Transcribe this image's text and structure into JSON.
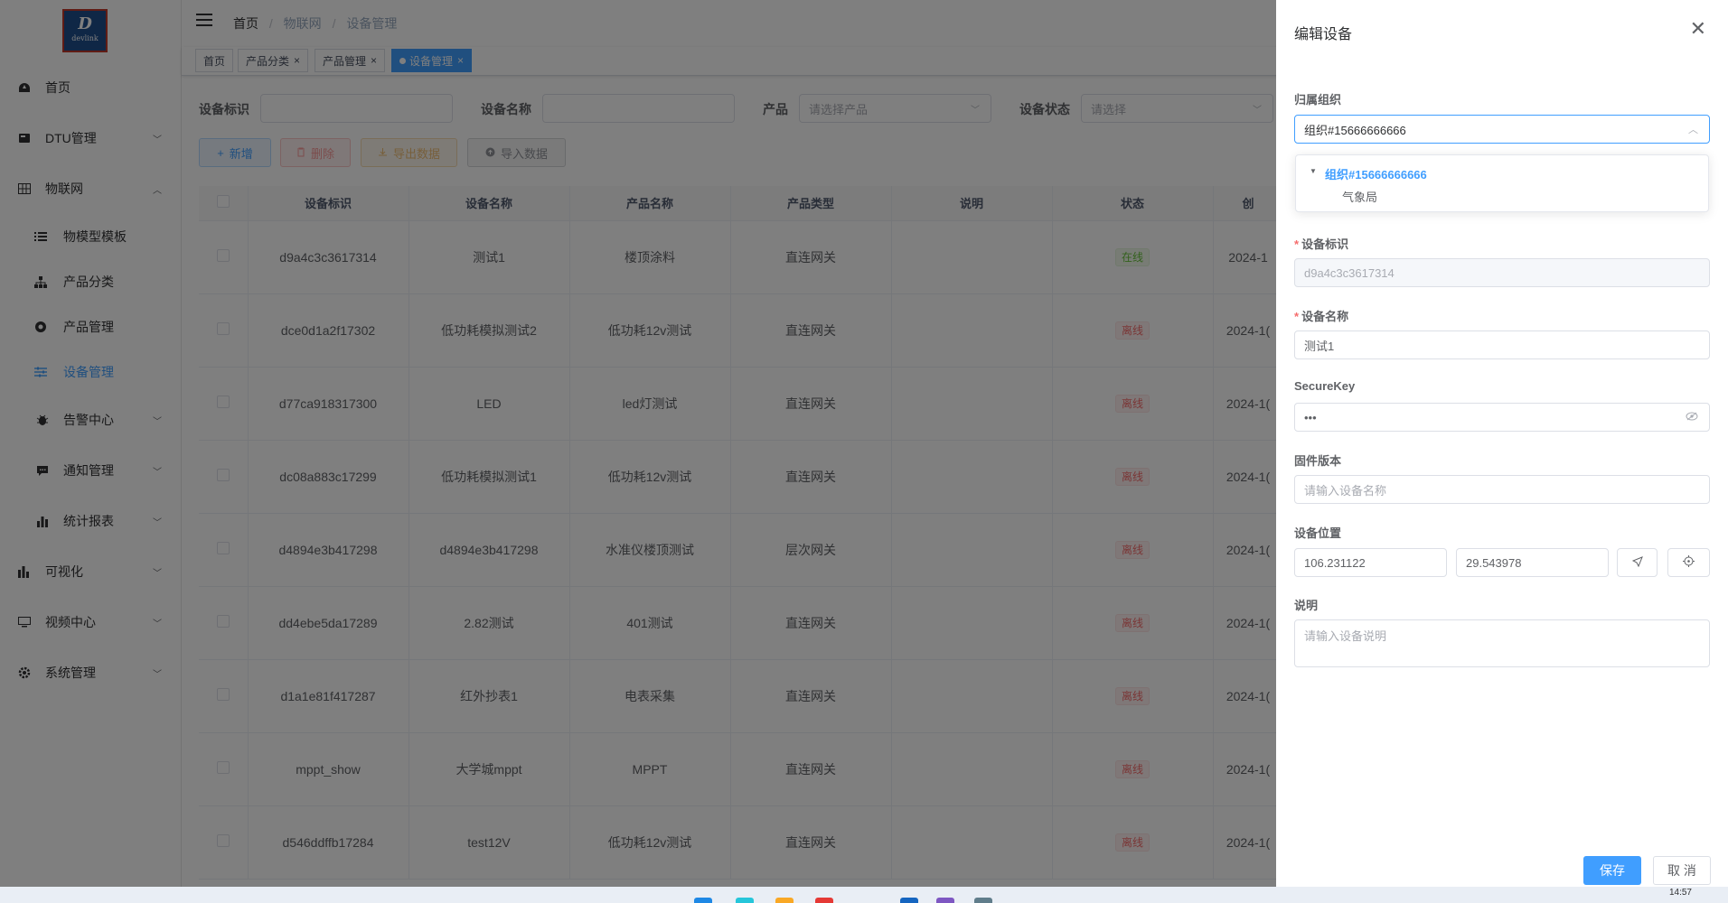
{
  "sidebar": {
    "logo_initial": "D",
    "logo_text": "devlink",
    "items": [
      {
        "label": "首页",
        "icon": "dashboard-icon",
        "expanded": null
      },
      {
        "label": "DTU管理",
        "icon": "dtu-icon",
        "expanded": false
      },
      {
        "label": "物联网",
        "icon": "grid-icon",
        "expanded": true
      },
      {
        "label": "物模型模板",
        "icon": "list-icon",
        "sub": true
      },
      {
        "label": "产品分类",
        "icon": "tree-icon",
        "sub": true
      },
      {
        "label": "产品管理",
        "icon": "product-icon",
        "sub": true
      },
      {
        "label": "设备管理",
        "icon": "sliders-icon",
        "sub": true,
        "active": true
      },
      {
        "label": "告警中心",
        "icon": "bug-icon",
        "expanded": false
      },
      {
        "label": "通知管理",
        "icon": "message-icon",
        "expanded": false
      },
      {
        "label": "统计报表",
        "icon": "bar-chart-icon",
        "expanded": false
      },
      {
        "label": "可视化",
        "icon": "chart-icon",
        "expanded": false
      },
      {
        "label": "视频中心",
        "icon": "monitor-icon",
        "expanded": false
      },
      {
        "label": "系统管理",
        "icon": "gear-icon",
        "expanded": false
      }
    ]
  },
  "breadcrumb": [
    "首页",
    "物联网",
    "设备管理"
  ],
  "tags": [
    {
      "label": "首页",
      "closable": false
    },
    {
      "label": "产品分类",
      "closable": true
    },
    {
      "label": "产品管理",
      "closable": true
    },
    {
      "label": "设备管理",
      "closable": true,
      "active": true
    }
  ],
  "filters": {
    "device_id_label": "设备标识",
    "device_name_label": "设备名称",
    "product_label": "产品",
    "product_placeholder": "请选择产品",
    "status_label": "设备状态",
    "status_placeholder": "请选择"
  },
  "toolbar": {
    "add": "新增",
    "delete": "删除",
    "export": "导出数据",
    "import": "导入数据"
  },
  "table": {
    "columns": [
      "设备标识",
      "设备名称",
      "产品名称",
      "产品类型",
      "说明",
      "状态",
      "创"
    ],
    "rows": [
      {
        "id": "d9a4c3c3617314",
        "name": "测试1",
        "product": "楼顶涂料",
        "type": "直连网关",
        "desc": "",
        "status": "在线",
        "online": true,
        "created": "2024-1"
      },
      {
        "id": "dce0d1a2f17302",
        "name": "低功耗模拟测试2",
        "product": "低功耗12v测试",
        "type": "直连网关",
        "desc": "",
        "status": "离线",
        "online": false,
        "created": "2024-1("
      },
      {
        "id": "d77ca918317300",
        "name": "LED",
        "product": "led灯测试",
        "type": "直连网关",
        "desc": "",
        "status": "离线",
        "online": false,
        "created": "2024-1("
      },
      {
        "id": "dc08a883c17299",
        "name": "低功耗模拟测试1",
        "product": "低功耗12v测试",
        "type": "直连网关",
        "desc": "",
        "status": "离线",
        "online": false,
        "created": "2024-1("
      },
      {
        "id": "d4894e3b417298",
        "name": "d4894e3b417298",
        "product": "水准仪楼顶测试",
        "type": "层次网关",
        "desc": "",
        "status": "离线",
        "online": false,
        "created": "2024-1("
      },
      {
        "id": "dd4ebe5da17289",
        "name": "2.82测试",
        "product": "401测试",
        "type": "直连网关",
        "desc": "",
        "status": "离线",
        "online": false,
        "created": "2024-1("
      },
      {
        "id": "d1a1e81f417287",
        "name": "红外抄表1",
        "product": "电表采集",
        "type": "直连网关",
        "desc": "",
        "status": "离线",
        "online": false,
        "created": "2024-1("
      },
      {
        "id": "mppt_show",
        "name": "大学城mppt",
        "product": "MPPT",
        "type": "直连网关",
        "desc": "",
        "status": "离线",
        "online": false,
        "created": "2024-1("
      },
      {
        "id": "d546ddffb17284",
        "name": "test12V",
        "product": "低功耗12v测试",
        "type": "直连网关",
        "desc": "",
        "status": "离线",
        "online": false,
        "created": "2024-1("
      }
    ]
  },
  "drawer": {
    "title": "编辑设备",
    "org_label": "归属组织",
    "org_value": "组织#15666666666",
    "org_tree": {
      "root": "组织#15666666666",
      "child": "气象局"
    },
    "device_id_label": "设备标识",
    "device_id_value": "d9a4c3c3617314",
    "device_name_label": "设备名称",
    "device_name_value": "测试1",
    "securekey_label": "SecureKey",
    "securekey_value": "•••",
    "firmware_label": "固件版本",
    "firmware_placeholder": "请输入设备名称",
    "location_label": "设备位置",
    "longitude": "106.231122",
    "latitude": "29.543978",
    "desc_label": "说明",
    "desc_placeholder": "请输入设备说明",
    "save": "保存",
    "cancel": "取 消"
  },
  "taskbar": {
    "time": "14:57"
  },
  "colors": {
    "primary": "#409eff",
    "danger": "#f56c6c",
    "success": "#67c23a",
    "warning": "#e6a23c"
  }
}
